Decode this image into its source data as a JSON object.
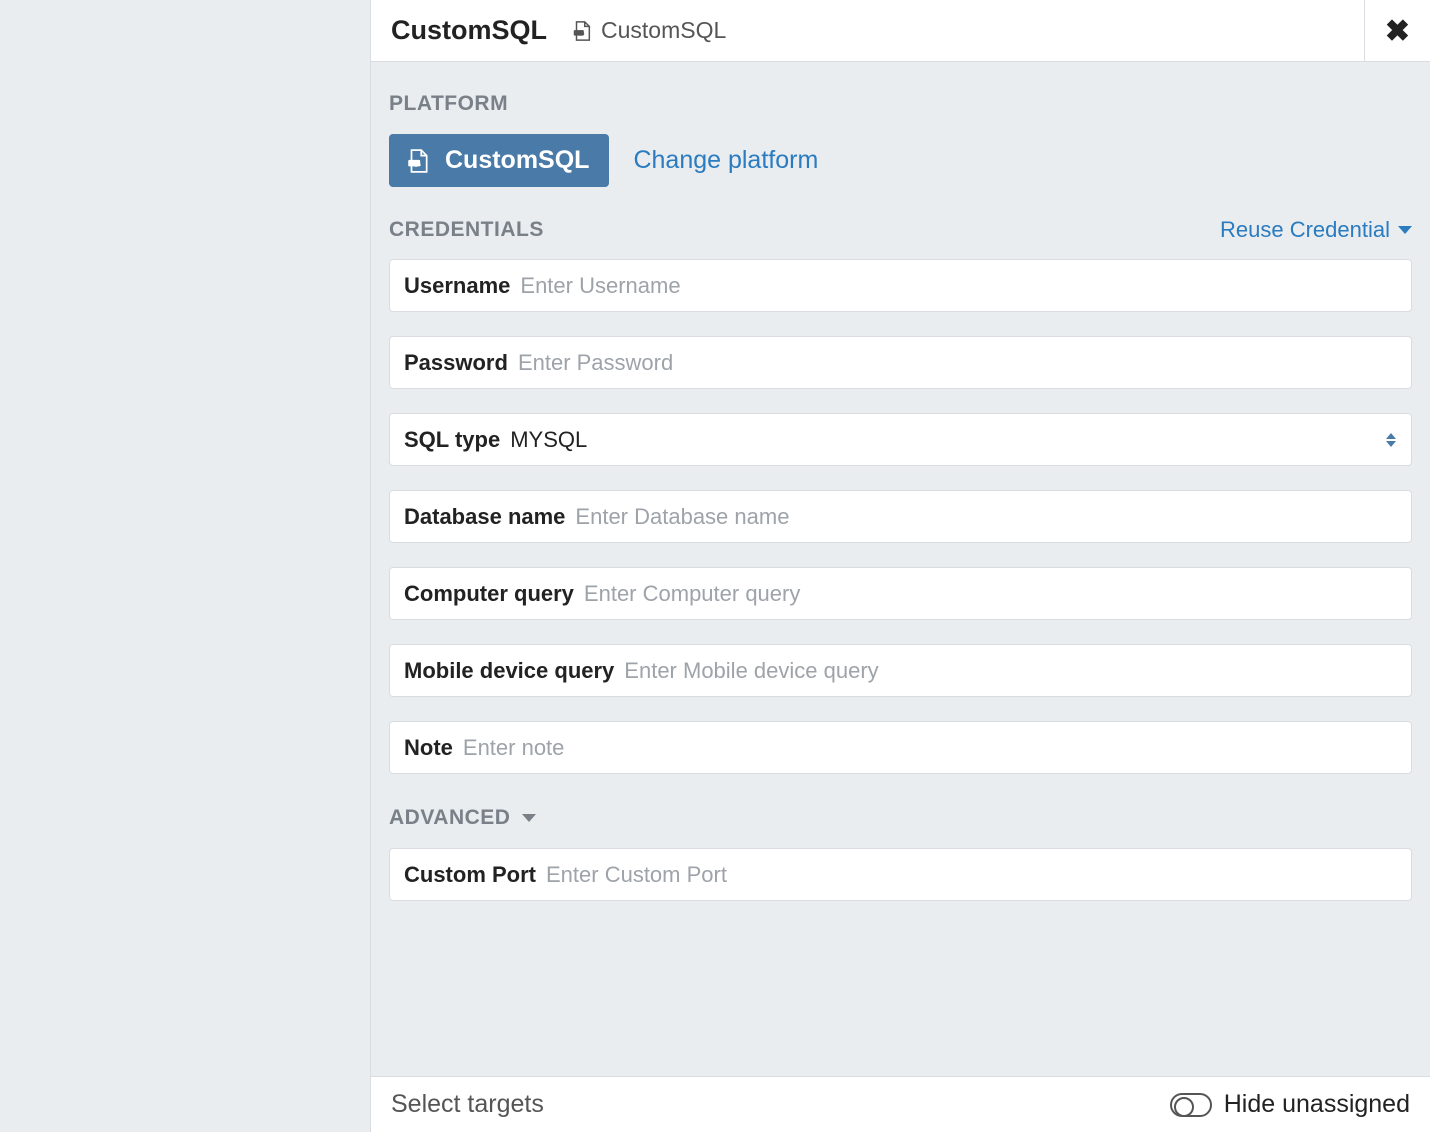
{
  "header": {
    "title": "CustomSQL",
    "subtitle": "CustomSQL"
  },
  "sections": {
    "platform_label": "PLATFORM",
    "credentials_label": "CREDENTIALS",
    "advanced_label": "ADVANCED"
  },
  "platform": {
    "selected": "CustomSQL",
    "change_link": "Change platform"
  },
  "credentials": {
    "reuse_link": "Reuse Credential",
    "username": {
      "label": "Username",
      "placeholder": "Enter Username",
      "value": ""
    },
    "password": {
      "label": "Password",
      "placeholder": "Enter Password",
      "value": ""
    },
    "sql_type": {
      "label": "SQL type",
      "value": "MYSQL"
    },
    "database_name": {
      "label": "Database name",
      "placeholder": "Enter Database name",
      "value": ""
    },
    "computer_query": {
      "label": "Computer query",
      "placeholder": "Enter Computer query",
      "value": ""
    },
    "mobile_device_query": {
      "label": "Mobile device query",
      "placeholder": "Enter Mobile device query",
      "value": ""
    },
    "note": {
      "label": "Note",
      "placeholder": "Enter note",
      "value": ""
    }
  },
  "advanced": {
    "custom_port": {
      "label": "Custom Port",
      "placeholder": "Enter Custom Port",
      "value": ""
    }
  },
  "targets": {
    "label": "Select targets",
    "hide_unassigned": "Hide unassigned"
  },
  "colors": {
    "accent": "#4a7aa7",
    "link": "#2a7bbf"
  }
}
